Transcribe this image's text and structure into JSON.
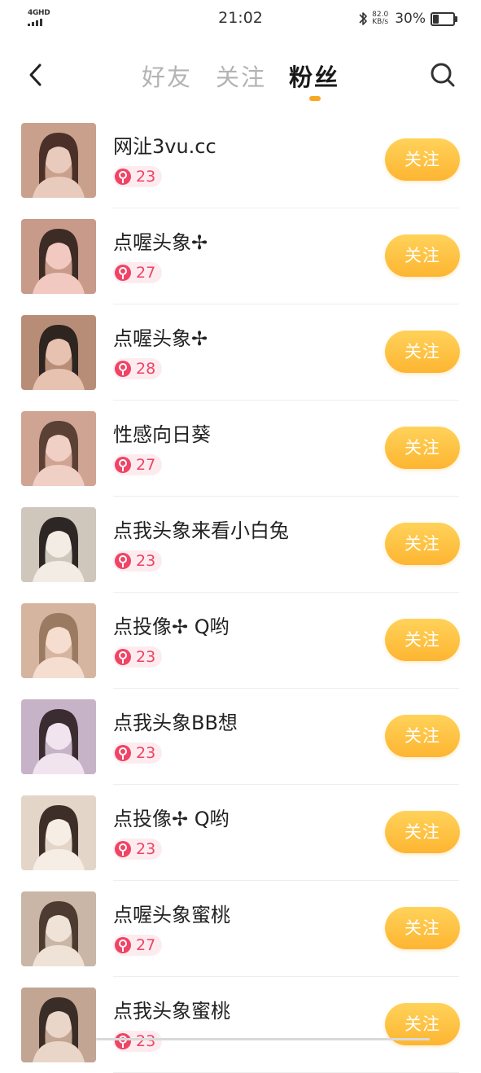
{
  "status_bar": {
    "network": "4GHD",
    "time": "21:02",
    "speed_value": "82.0",
    "speed_unit": "KB/s",
    "battery_percent": "30%",
    "battery_level": 0.3,
    "icons": [
      "signal-icon",
      "bluetooth-icon",
      "battery-icon"
    ]
  },
  "header": {
    "back_icon": "chevron-left-icon",
    "search_icon": "search-icon",
    "tabs": [
      {
        "label": "好友",
        "active": false
      },
      {
        "label": "关注",
        "active": false
      },
      {
        "label": "粉丝",
        "active": true
      }
    ],
    "accent_color": "#f7a823"
  },
  "list": {
    "follow_label": "关注",
    "badge_icon": "female-icon",
    "items": [
      {
        "name": "网沚3vu.cc",
        "age": "23"
      },
      {
        "name": "点喔头象✢",
        "age": "27"
      },
      {
        "name": "点喔头象✢",
        "age": "28"
      },
      {
        "name": "性感向日葵",
        "age": "27"
      },
      {
        "name": "点我头象来看小白兔",
        "age": "23"
      },
      {
        "name": "点投像✢ Q哟",
        "age": "23"
      },
      {
        "name": "点我头象BB想",
        "age": "23"
      },
      {
        "name": "点投像✢ Q哟",
        "age": "23"
      },
      {
        "name": "点喔头象蜜桃",
        "age": "27"
      },
      {
        "name": "点我头象蜜桃",
        "age": "23"
      }
    ]
  },
  "colors": {
    "button_gradient_top": "#ffd25a",
    "button_gradient_bottom": "#fdb531",
    "badge_pink": "#ee4466",
    "badge_bg": "#fdecef"
  }
}
